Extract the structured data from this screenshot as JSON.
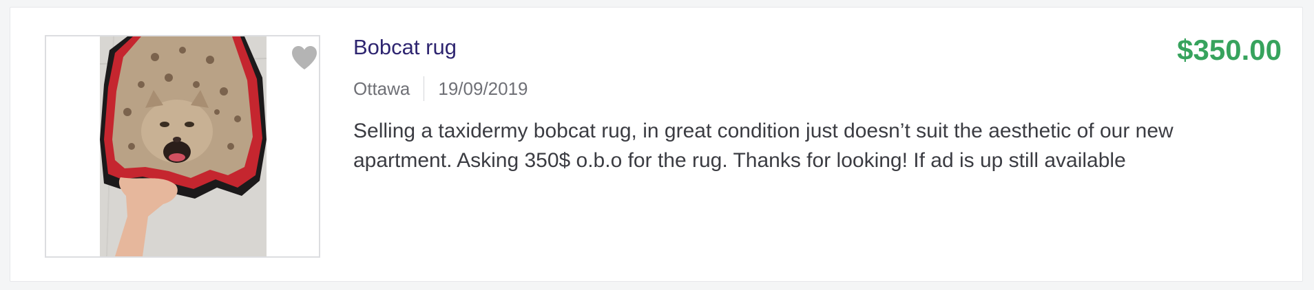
{
  "listing": {
    "title": "Bobcat rug",
    "price": "$350.00",
    "location": "Ottawa",
    "date": "19/09/2019",
    "description": "Selling a taxidermy bobcat rug, in great condition just doesn’t suit the aesthetic of our new apartment. Asking 350$ o.b.o for the rug. Thanks for looking! If ad is up still available",
    "favorite_icon": "heart-icon"
  },
  "colors": {
    "title": "#2e2570",
    "price": "#37a35d",
    "meta_text": "#6f7076",
    "body_text": "#3b3c42"
  }
}
